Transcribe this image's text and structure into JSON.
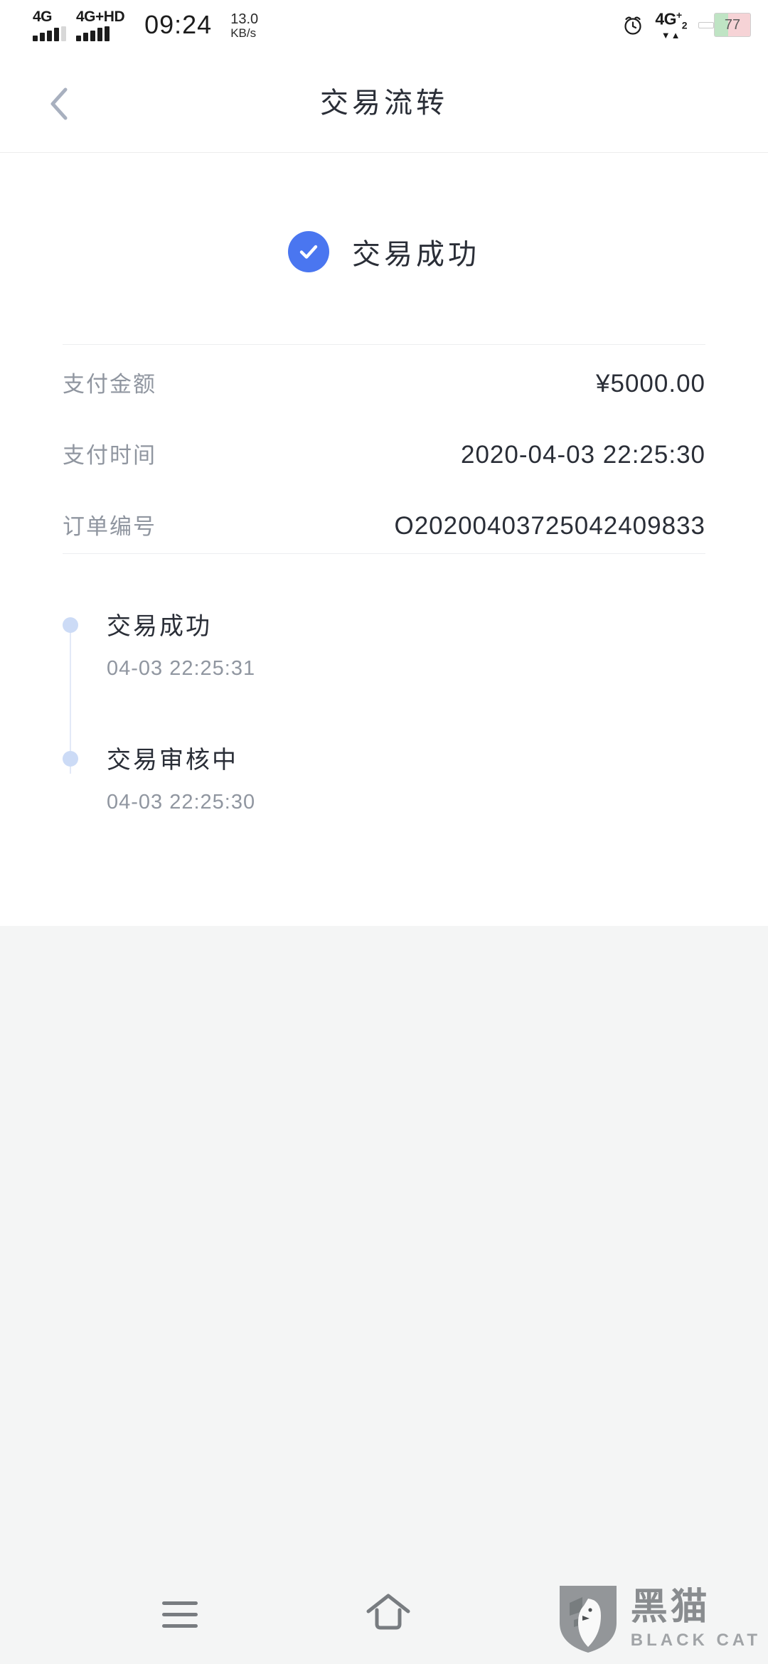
{
  "status_bar": {
    "carrier_1": {
      "label": "4G",
      "bars_total": 5,
      "bars_active": 4
    },
    "carrier_2": {
      "label": "4G+HD",
      "bars_total": 5,
      "bars_active": 5
    },
    "time": "09:24",
    "network_speed_value": "13.0",
    "network_speed_unit": "KB/s",
    "alarm_icon": "alarm-clock-icon",
    "data_network": {
      "label": "4G",
      "sup": "+",
      "sub": "2",
      "arrows": "▼▲"
    },
    "battery_percent": "77"
  },
  "header": {
    "back_icon": "chevron-left-icon",
    "title": "交易流转"
  },
  "result": {
    "icon": "check-circle-icon",
    "icon_color": "#4a76f0",
    "text": "交易成功"
  },
  "details": [
    {
      "label": "支付金额",
      "value": "¥5000.00"
    },
    {
      "label": "支付时间",
      "value": "2020-04-03 22:25:30"
    },
    {
      "label": "订单编号",
      "value": "O20200403725042409833"
    }
  ],
  "timeline": {
    "dot_color": "#ccdbf6",
    "items": [
      {
        "title": "交易成功",
        "time": "04-03 22:25:31"
      },
      {
        "title": "交易审核中",
        "time": "04-03 22:25:30"
      }
    ]
  },
  "nav_bar": {
    "recents_icon": "menu-lines-icon",
    "home_icon": "home-icon"
  },
  "watermark": {
    "shield_icon": "black-cat-shield-icon",
    "brand_cn": "黑猫",
    "brand_en": "BLACK CAT"
  }
}
